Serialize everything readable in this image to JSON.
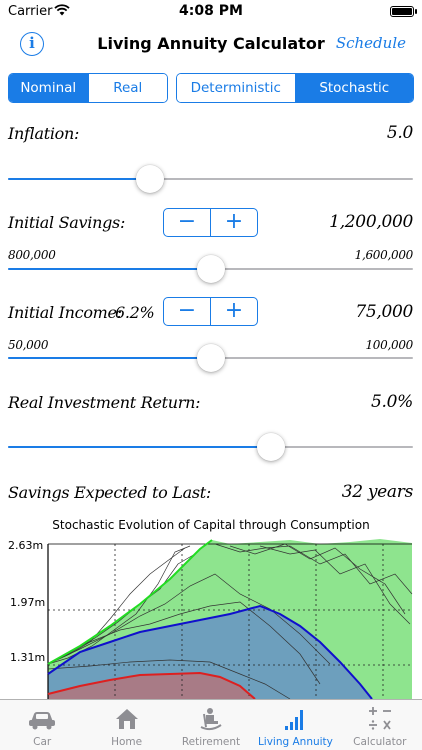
{
  "status": {
    "carrier": "Carrier",
    "time": "4:08 PM"
  },
  "nav": {
    "info": "i",
    "title": "Living Annuity Calculator",
    "right_button": "Schedule"
  },
  "segments": {
    "mode": {
      "options": [
        "Nominal",
        "Real"
      ],
      "selected": 0
    },
    "method": {
      "options": [
        "Deterministic",
        "Stochastic"
      ],
      "selected": 1
    }
  },
  "inflation": {
    "label": "Inflation:",
    "value": "5.0",
    "slider_fraction": 0.35
  },
  "savings": {
    "label": "Initial Savings:",
    "value": "1,200,000",
    "min_label": "800,000",
    "max_label": "1,600,000",
    "minus": "−",
    "plus": "+",
    "slider_fraction": 0.5
  },
  "income": {
    "label": "Initial Income:",
    "percent": "6.2%",
    "value": "75,000",
    "min_label": "50,000",
    "max_label": "100,000",
    "minus": "−",
    "plus": "+",
    "slider_fraction": 0.5
  },
  "return": {
    "label": "Real Investment Return:",
    "value": "5.0%",
    "slider_fraction": 0.65
  },
  "expected": {
    "label": "Savings Expected to Last:",
    "value": "32 years"
  },
  "chart_data": {
    "type": "area",
    "title": "Stochastic Evolution of Capital through Consumption",
    "y_ticks": [
      "2.63m",
      "1.97m",
      "1.31m"
    ],
    "colors": {
      "upper_band": "#8ee48e",
      "upper_line": "#22dd22",
      "mid_band": "#6d9fbd",
      "mid_line": "#1010cc",
      "low_band": "#a87b86",
      "low_line": "#dd2020"
    }
  },
  "tabs": [
    {
      "label": "Car",
      "icon": "car-icon"
    },
    {
      "label": "Home",
      "icon": "home-icon"
    },
    {
      "label": "Retirement",
      "icon": "rocking-chair-icon"
    },
    {
      "label": "Living Annuity",
      "icon": "bar-chart-icon"
    },
    {
      "label": "Calculator",
      "icon": "calculator-icon"
    }
  ],
  "active_tab": 3
}
